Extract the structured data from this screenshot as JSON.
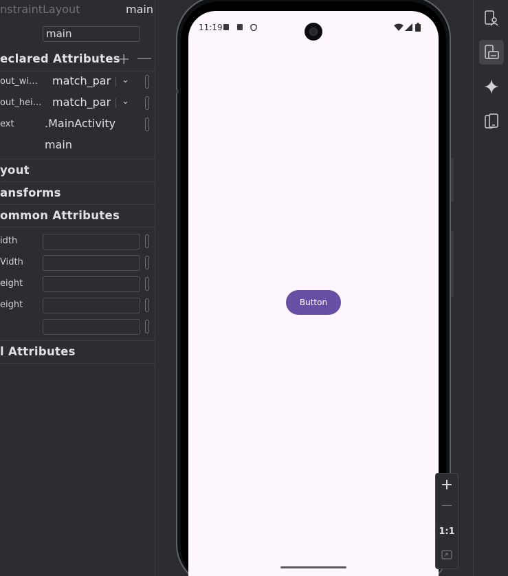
{
  "panel": {
    "top_row": {
      "label": "nstraintLayout",
      "value": "main"
    },
    "id_field": {
      "value": "main"
    },
    "declared": {
      "title": "eclared Attributes",
      "add_label": "+",
      "remove_label": "—",
      "rows": [
        {
          "label": "out_wi…",
          "value": "match_par"
        },
        {
          "label": "out_hei…",
          "value": "match_par"
        },
        {
          "label": "ext",
          "value": ".MainActivity"
        },
        {
          "label": "",
          "value": "main"
        }
      ]
    },
    "sections": {
      "layout": "yout",
      "transforms": "ansforms",
      "common": "ommon Attributes",
      "all": "l Attributes"
    },
    "common_rows": [
      {
        "label": "idth"
      },
      {
        "label": "Vidth"
      },
      {
        "label": "eight"
      },
      {
        "label": "eight"
      },
      {
        "label": ""
      }
    ]
  },
  "device": {
    "status_time": "11:19",
    "button_label": "Button"
  },
  "zoom": {
    "zoom_in": "+",
    "zoom_out": "—",
    "one_to_one": "1:1"
  },
  "colors": {
    "accent": "#6750a4",
    "screen_bg": "#fdf6fd",
    "ide_bg": "#2b2d30"
  },
  "icons": {
    "toolbar": [
      "device-manager-icon",
      "running-devices-icon",
      "gemini-icon",
      "device-mirroring-icon"
    ]
  }
}
